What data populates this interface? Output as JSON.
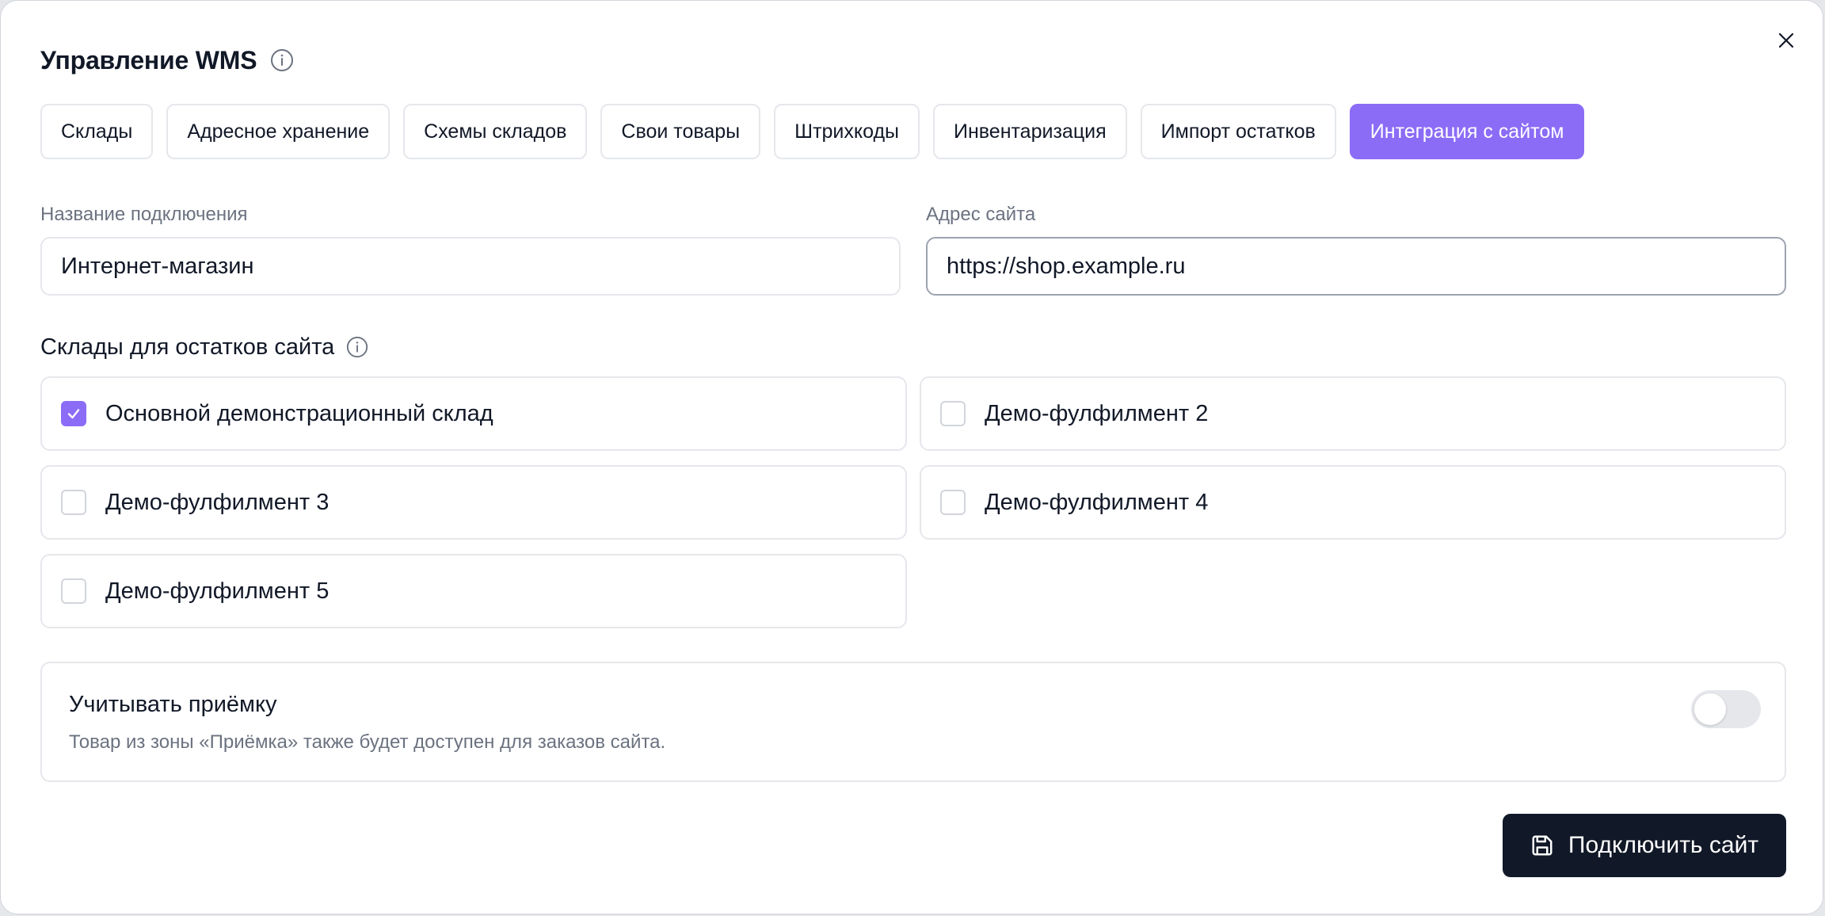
{
  "dialog": {
    "title": "Управление WMS",
    "info_icon": "info-icon",
    "close_icon": "close-icon"
  },
  "tabs": [
    {
      "label": "Склады",
      "active": false
    },
    {
      "label": "Адресное хранение",
      "active": false
    },
    {
      "label": "Схемы складов",
      "active": false
    },
    {
      "label": "Свои товары",
      "active": false
    },
    {
      "label": "Штрихкоды",
      "active": false
    },
    {
      "label": "Инвентаризация",
      "active": false
    },
    {
      "label": "Импорт остатков",
      "active": false
    },
    {
      "label": "Интеграция с сайтом",
      "active": true
    }
  ],
  "form": {
    "connection_name": {
      "label": "Название подключения",
      "value": "Интернет-магазин"
    },
    "site_address": {
      "label": "Адрес сайта",
      "value": "https://shop.example.ru"
    }
  },
  "warehouses": {
    "title": "Склады для остатков сайта",
    "items": [
      {
        "label": "Основной демонстрационный склад",
        "checked": true
      },
      {
        "label": "Демо-фулфилмент 2",
        "checked": false
      },
      {
        "label": "Демо-фулфилмент 3",
        "checked": false
      },
      {
        "label": "Демо-фулфилмент 4",
        "checked": false
      },
      {
        "label": "Демо-фулфилмент 5",
        "checked": false
      }
    ]
  },
  "receiving": {
    "title": "Учитывать приёмку",
    "description": "Товар из зоны «Приёмка» также будет доступен для заказов сайта.",
    "enabled": false
  },
  "submit": {
    "label": "Подключить сайт",
    "icon": "save-icon"
  },
  "colors": {
    "accent": "#8b6cf6",
    "primary_button": "#111827",
    "border": "#e5e7eb",
    "muted_text": "#6b7280"
  }
}
